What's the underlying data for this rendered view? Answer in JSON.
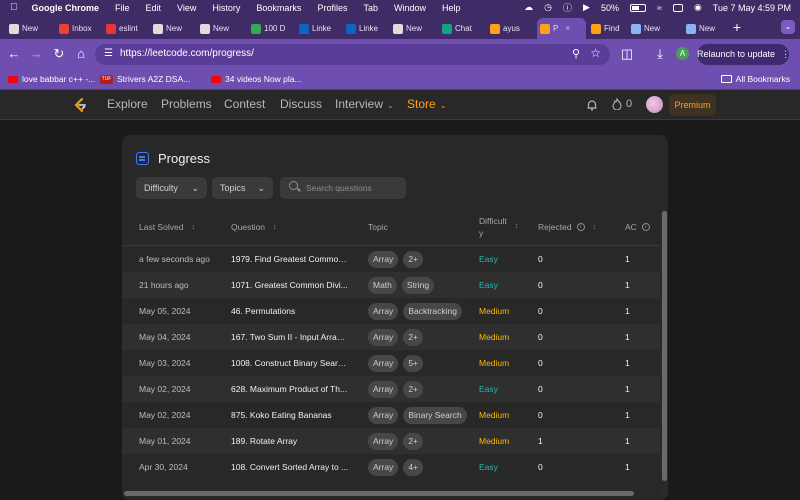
{
  "menubar": {
    "app_name": "Google Chrome",
    "items": [
      "File",
      "Edit",
      "View",
      "History",
      "Bookmarks",
      "Profiles",
      "Tab",
      "Window",
      "Help"
    ],
    "battery": "50%",
    "datetime": "Tue 7 May  4:59 PM"
  },
  "tabs": [
    {
      "title": "New",
      "color": "#dddddd"
    },
    {
      "title": "Inbox",
      "color": "#ea4335"
    },
    {
      "title": "eslint",
      "color": "#e53935"
    },
    {
      "title": "New",
      "color": "#dddddd"
    },
    {
      "title": "New",
      "color": "#dddddd"
    },
    {
      "title": "100 D",
      "color": "#34a853"
    },
    {
      "title": "Linke",
      "color": "#0a66c2"
    },
    {
      "title": "Linke",
      "color": "#0a66c2"
    },
    {
      "title": "New",
      "color": "#dddddd"
    },
    {
      "title": "Chat",
      "color": "#10a37f"
    },
    {
      "title": "ayus",
      "color": "#ffa116"
    },
    {
      "title": "P",
      "color": "#ffa116"
    },
    {
      "title": "Find",
      "color": "#ffa116"
    },
    {
      "title": "New",
      "color": "#8ab4f8"
    },
    {
      "title": "New",
      "color": "#8ab4f8"
    }
  ],
  "toolbar": {
    "url": "https://leetcode.com/progress/",
    "relaunch_label": "Relaunch to update",
    "profile_initial": "A"
  },
  "bookmarks": {
    "items": [
      {
        "label": "love babbar c++ -..."
      },
      {
        "label": "Strivers A2Z DSA..."
      },
      {
        "label": "34 videos Now pla..."
      }
    ],
    "all_label": "All Bookmarks"
  },
  "nav": {
    "links": [
      "Explore",
      "Problems",
      "Contest",
      "Discuss",
      "Interview",
      "Store"
    ],
    "streak_count": "0",
    "premium_label": "Premium"
  },
  "progress": {
    "title": "Progress",
    "filters": {
      "difficulty": "Difficulty",
      "topics": "Topics",
      "search_placeholder": "Search questions"
    },
    "columns": {
      "last_solved": "Last Solved",
      "question": "Question",
      "topic": "Topic",
      "difficulty_line1": "Difficult",
      "difficulty_line2": "y",
      "rejected": "Rejected",
      "ac": "AC"
    },
    "rows": [
      {
        "last_solved": "a few seconds ago",
        "question": "1979. Find Greatest Common...",
        "tags": [
          "Array",
          "2+"
        ],
        "difficulty": "Easy",
        "rejected": "0",
        "ac": "1"
      },
      {
        "last_solved": "21 hours ago",
        "question": "1071. Greatest Common Divi...",
        "tags": [
          "Math",
          "String"
        ],
        "difficulty": "Easy",
        "rejected": "0",
        "ac": "1"
      },
      {
        "last_solved": "May 05, 2024",
        "question": "46. Permutations",
        "tags": [
          "Array",
          "Backtracking"
        ],
        "difficulty": "Medium",
        "rejected": "0",
        "ac": "1"
      },
      {
        "last_solved": "May 04, 2024",
        "question": "167. Two Sum II - Input Array ...",
        "tags": [
          "Array",
          "2+"
        ],
        "difficulty": "Medium",
        "rejected": "0",
        "ac": "1"
      },
      {
        "last_solved": "May 03, 2024",
        "question": "1008. Construct Binary Searc...",
        "tags": [
          "Array",
          "5+"
        ],
        "difficulty": "Medium",
        "rejected": "0",
        "ac": "1"
      },
      {
        "last_solved": "May 02, 2024",
        "question": "628. Maximum Product of Th...",
        "tags": [
          "Array",
          "2+"
        ],
        "difficulty": "Easy",
        "rejected": "0",
        "ac": "1"
      },
      {
        "last_solved": "May 02, 2024",
        "question": "875. Koko Eating Bananas",
        "tags": [
          "Array",
          "Binary Search"
        ],
        "difficulty": "Medium",
        "rejected": "0",
        "ac": "1"
      },
      {
        "last_solved": "May 01, 2024",
        "question": "189. Rotate Array",
        "tags": [
          "Array",
          "2+"
        ],
        "difficulty": "Medium",
        "rejected": "1",
        "ac": "1"
      },
      {
        "last_solved": "Apr 30, 2024",
        "question": "108. Convert Sorted Array to ...",
        "tags": [
          "Array",
          "4+"
        ],
        "difficulty": "Easy",
        "rejected": "0",
        "ac": "1"
      }
    ]
  },
  "colors": {
    "easy": "#1cbaba",
    "medium": "#ffb800",
    "brand": "#ffa116",
    "chrome_frame": "#3f2b66",
    "chrome_toolbar": "#6e4fb0"
  }
}
